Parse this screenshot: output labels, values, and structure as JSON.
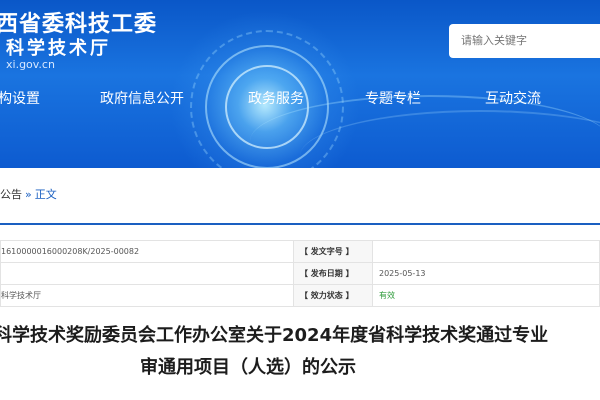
{
  "header": {
    "org_line1": "西省委科技工委",
    "org_line2": "科学技术厅",
    "url_fragment": "xi.gov.cn",
    "search_placeholder": "请输入关键字",
    "colors": {
      "banner": "#1a74e0",
      "accent": "#1a5fc1"
    }
  },
  "nav": {
    "items": [
      {
        "label": "构设置"
      },
      {
        "label": "政府信息公开"
      },
      {
        "label": "政务服务"
      },
      {
        "label": "专题专栏"
      },
      {
        "label": "互动交流"
      }
    ]
  },
  "breadcrumb": {
    "parent": "公告",
    "separator": "»",
    "current": "正文"
  },
  "info": {
    "rows": [
      {
        "value_left": "1610000016000208K/2025-00082",
        "label": "【 发文字号 】",
        "value_right": ""
      },
      {
        "value_left": "",
        "label": "【 发布日期 】",
        "value_right": "2025-05-13"
      },
      {
        "value_left": "科学技术厅",
        "label": "【 效力状态 】",
        "value_right": "有效"
      }
    ]
  },
  "article": {
    "title_line1": "科学技术奖励委员会工作办公室关于2024年度省科学技术奖通过专业",
    "title_line2": "审通用项目（人选）的公示"
  }
}
